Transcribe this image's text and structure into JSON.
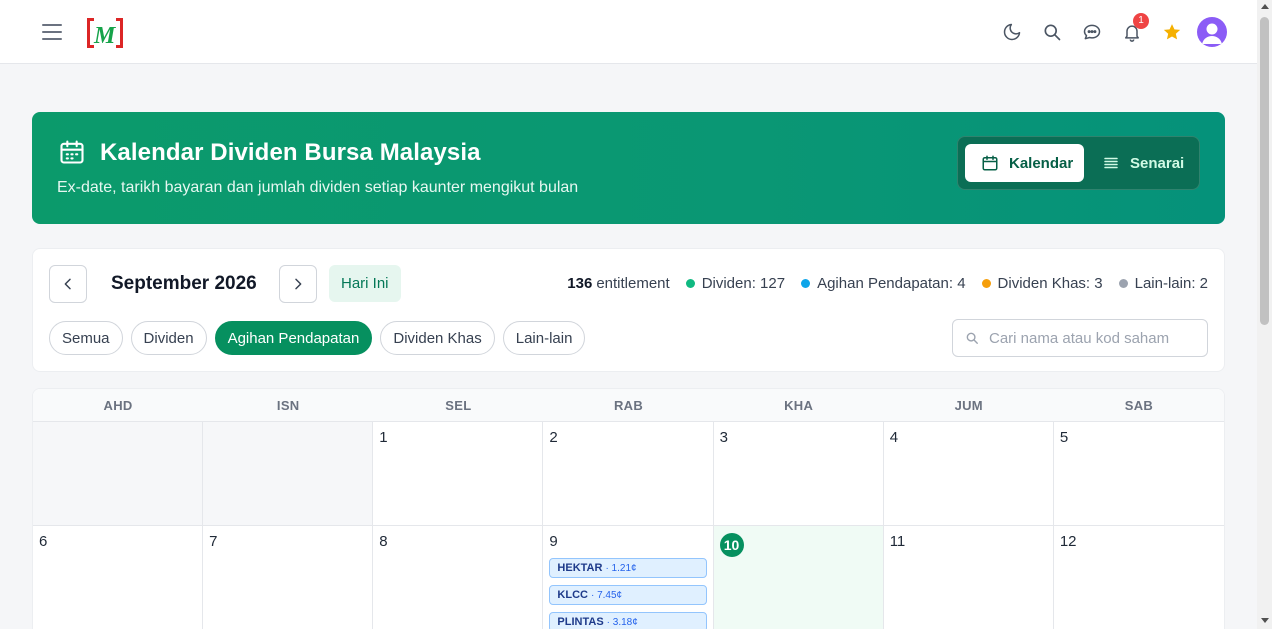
{
  "header": {
    "icons": [
      "hamburger-icon",
      "logo",
      "moon-icon",
      "search-icon",
      "chat-icon",
      "bell-icon",
      "star-icon",
      "avatar"
    ],
    "notifications_count": "1",
    "logo_text": "M"
  },
  "banner": {
    "title": "Kalendar Dividen Bursa Malaysia",
    "subtitle": "Ex-date, tarikh bayaran dan jumlah dividen setiap kaunter mengikut bulan",
    "view_calendar": "Kalendar",
    "view_list": "Senarai",
    "bg_color": "#0b9a6b"
  },
  "filters": {
    "month": "September 2026",
    "today_label": "Hari Ini",
    "entitlement_count": "136",
    "entitlement_label": "entitlement",
    "stats": [
      {
        "label": "Dividen: 127",
        "color": "#10b981"
      },
      {
        "label": "Agihan Pendapatan: 4",
        "color": "#0ea5e9"
      },
      {
        "label": "Dividen Khas: 3",
        "color": "#f59e0b"
      },
      {
        "label": "Lain-lain: 2",
        "color": "#9ca3af"
      }
    ],
    "chips": [
      "Semua",
      "Dividen",
      "Agihan Pendapatan",
      "Dividen Khas",
      "Lain-lain"
    ],
    "active_chip": "Agihan Pendapatan",
    "search_placeholder": "Cari nama atau kod saham"
  },
  "calendar": {
    "days_of_week": [
      "AHD",
      "ISN",
      "SEL",
      "RAB",
      "KHA",
      "JUM",
      "SAB"
    ],
    "week1": [
      "",
      "",
      "1",
      "2",
      "3",
      "4",
      "5"
    ],
    "week2": [
      "6",
      "7",
      "8",
      "9",
      "10",
      "11",
      "12"
    ],
    "today": "10",
    "events_day9": [
      {
        "code": "HEKTAR",
        "amount": "· 1.21¢"
      },
      {
        "code": "KLCC",
        "amount": "· 7.45¢"
      },
      {
        "code": "PLINTAS",
        "amount": "· 3.18¢"
      }
    ]
  }
}
